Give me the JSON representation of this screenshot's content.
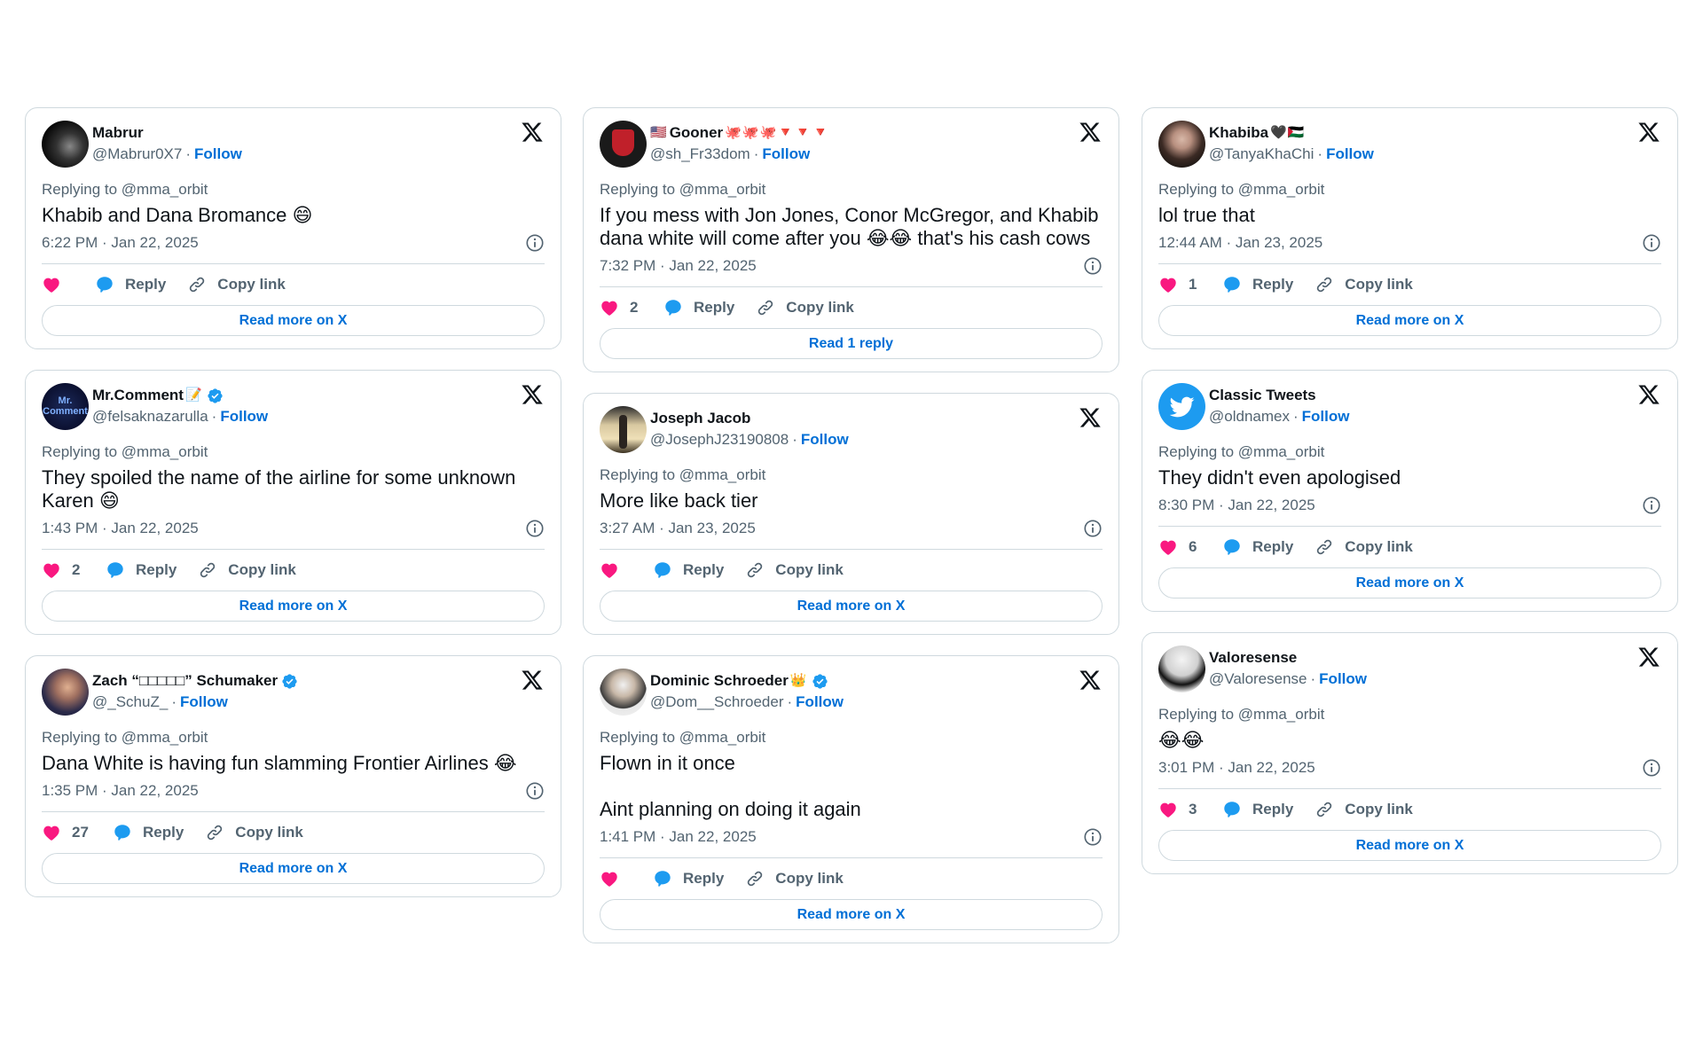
{
  "colors": {
    "heart": "#F91880",
    "reply_bubble": "#1D9BF0",
    "link_blue": "#006FD6",
    "muted_text": "#536471",
    "border": "#CFD9DE"
  },
  "common": {
    "replying_to": "Replying to @mma_orbit",
    "follow": "Follow",
    "reply": "Reply",
    "copy_link": "Copy link",
    "separator": "·"
  },
  "tweets": [
    {
      "name": "Mabrur",
      "name_emoji": "",
      "verified": false,
      "handle": "@Mabrur0X7",
      "text": "Khabib and Dana Bromance 😄",
      "timestamp": "6:22 PM · Jan 22, 2025",
      "likes": "",
      "button": "Read more on X",
      "avatar": "chess-pieces-avatar"
    },
    {
      "name": "Gooner",
      "name_prefix_emoji": "🇺🇸",
      "name_emoji": "🐙🐙🐙🔻🔻🔻",
      "verified": false,
      "handle": "@sh_Fr33dom",
      "text": "If you mess with Jon Jones, Conor McGregor, and Khabib dana white will come after you 😂😂 that's his cash cows",
      "timestamp": "7:32 PM · Jan 22, 2025",
      "likes": "2",
      "button": "Read 1 reply",
      "avatar": "arsenal-crest-avatar"
    },
    {
      "name": "Khabiba",
      "name_emoji": "🖤🇵🇸",
      "verified": false,
      "handle": "@TanyaKhaChi",
      "text": "lol true that",
      "timestamp": "12:44 AM · Jan 23, 2025",
      "likes": "1",
      "button": "Read more on X",
      "avatar": "woman-portrait-avatar"
    },
    {
      "name": "Mr.Comment",
      "name_emoji": "📝",
      "verified": true,
      "handle": "@felsaknazarulla",
      "text": "They spoiled the name of the airline for some unknown Karen 😄",
      "timestamp": "1:43 PM · Jan 22, 2025",
      "likes": "2",
      "button": "Read more on X",
      "avatar": "mr-comment-logo-avatar",
      "avatar_text": "Mr. Comment"
    },
    {
      "name": "Joseph Jacob",
      "name_emoji": "",
      "verified": false,
      "handle": "@JosephJ23190808",
      "text": "More like back tier",
      "timestamp": "3:27 AM · Jan 23, 2025",
      "likes": "",
      "button": "Read more on X",
      "avatar": "silhouette-avatar"
    },
    {
      "name": "Classic Tweets",
      "name_emoji": "",
      "verified": false,
      "handle": "@oldnamex",
      "text": "They didn't even apologised",
      "timestamp": "8:30 PM · Jan 22, 2025",
      "likes": "6",
      "button": "Read more on X",
      "avatar": "twitter-bird-avatar"
    },
    {
      "name": "Zach “□□□□□” Schumaker",
      "name_emoji": "",
      "verified": true,
      "handle": "@_SchuZ_",
      "text": "Dana White is having fun slamming Frontier Airlines 😂",
      "timestamp": "1:35 PM · Jan 22, 2025",
      "likes": "27",
      "button": "Read more on X",
      "avatar": "man-portrait-avatar"
    },
    {
      "name": "Dominic Schroeder",
      "name_emoji": "👑",
      "verified": true,
      "handle": "@Dom__Schroeder",
      "text": "Flown in it once\n\nAint planning on doing it again",
      "timestamp": "1:41 PM · Jan 22, 2025",
      "likes": "",
      "button": "Read more on X",
      "avatar": "bald-man-glasses-avatar"
    },
    {
      "name": "Valoresense",
      "name_emoji": "",
      "verified": false,
      "handle": "@Valoresense",
      "text": "😂😂",
      "timestamp": "3:01 PM · Jan 22, 2025",
      "likes": "3",
      "button": "Read more on X",
      "avatar": "bw-portrait-avatar"
    }
  ]
}
